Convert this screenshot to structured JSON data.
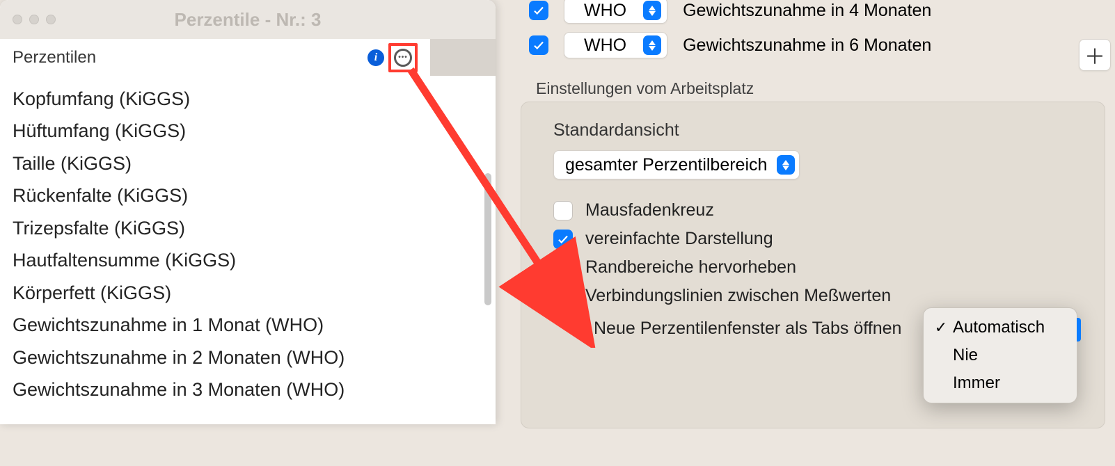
{
  "window": {
    "title": "Perzentile - Nr.: 3"
  },
  "tab": {
    "label": "Perzentilen"
  },
  "list": [
    "Kopfumfang (KiGGS)",
    "Hüftumfang (KiGGS)",
    "Taille (KiGGS)",
    "Rückenfalte (KiGGS)",
    "Trizepsfalte (KiGGS)",
    "Hautfaltensumme (KiGGS)",
    "Körperfett (KiGGS)",
    "Gewichtszunahme in 1 Monat (WHO)",
    "Gewichtszunahme in 2 Monaten (WHO)",
    "Gewichtszunahme in 3 Monaten (WHO)"
  ],
  "topRows": [
    {
      "checked": true,
      "select": "WHO",
      "label": "Gewichtszunahme in 4 Monaten"
    },
    {
      "checked": true,
      "select": "WHO",
      "label": "Gewichtszunahme in 6 Monaten"
    }
  ],
  "settings": {
    "heading": "Einstellungen vom Arbeitsplatz",
    "viewLabel": "Standardansicht",
    "viewSelect": "gesamter Perzentilbereich",
    "options": [
      {
        "checked": false,
        "label": "Mausfadenkreuz"
      },
      {
        "checked": true,
        "label": "vereinfachte Darstellung"
      },
      {
        "checked": false,
        "label": "Randbereiche hervorheben"
      },
      {
        "checked": true,
        "label": "Verbindungslinien zwischen Meßwerten"
      }
    ],
    "tabsLabel": "Neue Perzentilenfenster als Tabs öffnen"
  },
  "dropdown": {
    "items": [
      "Automatisch",
      "Nie",
      "Immer"
    ],
    "selectedIndex": 0
  },
  "icons": {
    "info": "i",
    "plus": "＋",
    "check": "✓"
  }
}
